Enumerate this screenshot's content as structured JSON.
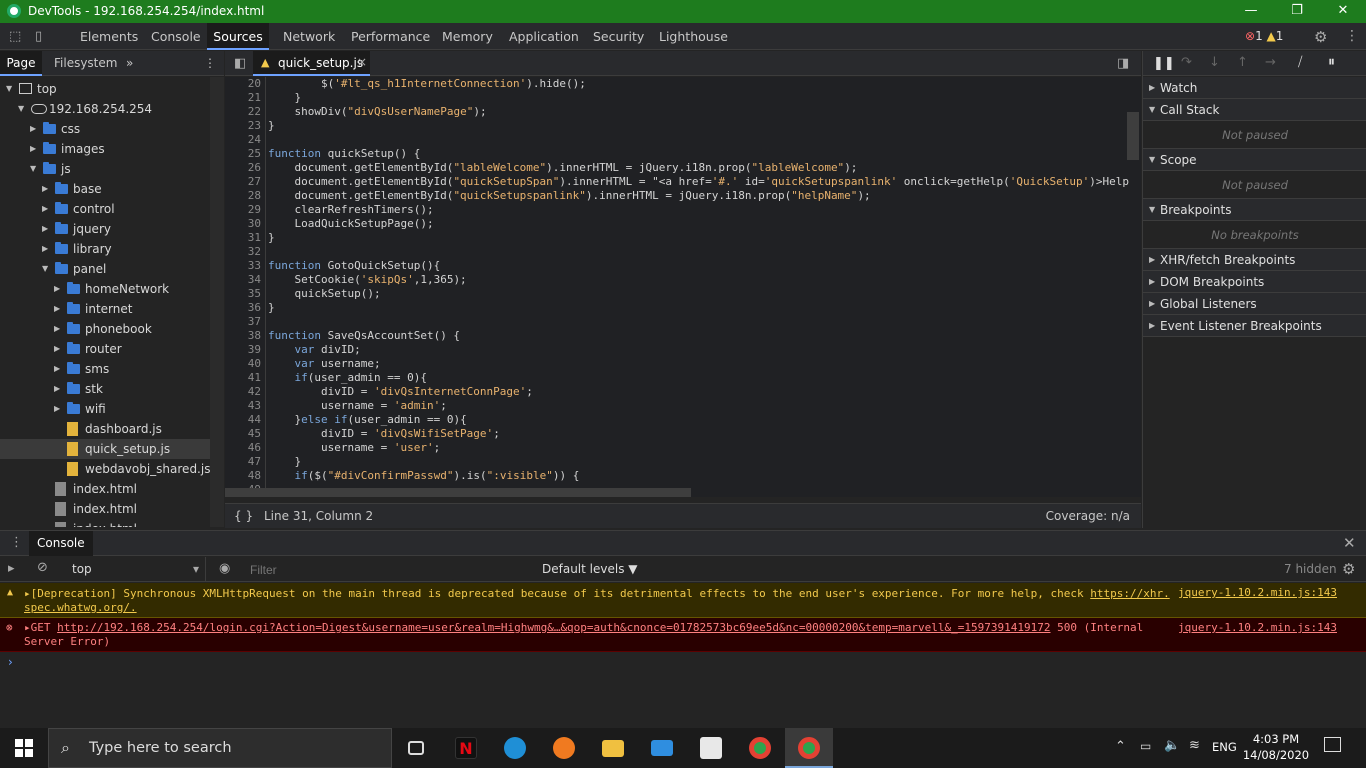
{
  "window": {
    "title": "DevTools - 192.168.254.254/index.html",
    "minimize_glyph": "—",
    "restore_glyph": "❐",
    "close_glyph": "✕"
  },
  "main_tabs": [
    {
      "label": "Elements"
    },
    {
      "label": "Console"
    },
    {
      "label": "Sources"
    },
    {
      "label": "Network"
    },
    {
      "label": "Performance"
    },
    {
      "label": "Memory"
    },
    {
      "label": "Application"
    },
    {
      "label": "Security"
    },
    {
      "label": "Lighthouse"
    }
  ],
  "active_main_tab": "Sources",
  "issues": {
    "errors": "1",
    "warnings": "1"
  },
  "navigator": {
    "tabs": [
      {
        "label": "Page"
      },
      {
        "label": "Filesystem"
      }
    ],
    "more": "»",
    "tree": [
      {
        "label": "top",
        "type": "frame"
      },
      {
        "label": "192.168.254.254",
        "type": "cloud"
      },
      {
        "label": "css",
        "type": "folder"
      },
      {
        "label": "images",
        "type": "folder"
      },
      {
        "label": "js",
        "type": "folder"
      },
      {
        "label": "base",
        "type": "folder"
      },
      {
        "label": "control",
        "type": "folder"
      },
      {
        "label": "jquery",
        "type": "folder"
      },
      {
        "label": "library",
        "type": "folder"
      },
      {
        "label": "panel",
        "type": "folder"
      },
      {
        "label": "homeNetwork",
        "type": "folder"
      },
      {
        "label": "internet",
        "type": "folder"
      },
      {
        "label": "phonebook",
        "type": "folder"
      },
      {
        "label": "router",
        "type": "folder"
      },
      {
        "label": "sms",
        "type": "folder"
      },
      {
        "label": "stk",
        "type": "folder"
      },
      {
        "label": "wifi",
        "type": "folder"
      },
      {
        "label": "dashboard.js",
        "type": "js"
      },
      {
        "label": "quick_setup.js",
        "type": "js"
      },
      {
        "label": "webdavobj_shared.js",
        "type": "js"
      },
      {
        "label": "index.html",
        "type": "html"
      },
      {
        "label": "index.html",
        "type": "html"
      },
      {
        "label": "index.html",
        "type": "html"
      }
    ]
  },
  "editor": {
    "tab_label": "quick_setup.js",
    "lines": [
      {
        "n": "20",
        "t": "        $('#lt_qs_h1InternetConnection').hide();"
      },
      {
        "n": "21",
        "t": "    }"
      },
      {
        "n": "22",
        "t": "    showDiv(\"divQsUserNamePage\");"
      },
      {
        "n": "23",
        "t": "}"
      },
      {
        "n": "24",
        "t": ""
      },
      {
        "n": "25",
        "t": "function quickSetup() {"
      },
      {
        "n": "26",
        "t": "    document.getElementById(\"lableWelcome\").innerHTML = jQuery.i18n.prop(\"lableWelcome\");"
      },
      {
        "n": "27",
        "t": "    document.getElementById(\"quickSetupSpan\").innerHTML = \"<a href='#.' id='quickSetupspanlink' onclick=getHelp('QuickSetup')>Help"
      },
      {
        "n": "28",
        "t": "    document.getElementById(\"quickSetupspanlink\").innerHTML = jQuery.i18n.prop(\"helpName\");"
      },
      {
        "n": "29",
        "t": "    clearRefreshTimers();"
      },
      {
        "n": "30",
        "t": "    LoadQuickSetupPage();"
      },
      {
        "n": "31",
        "t": "}"
      },
      {
        "n": "32",
        "t": ""
      },
      {
        "n": "33",
        "t": "function GotoQuickSetup(){"
      },
      {
        "n": "34",
        "t": "    SetCookie('skipQs',1,365);"
      },
      {
        "n": "35",
        "t": "    quickSetup();"
      },
      {
        "n": "36",
        "t": "}"
      },
      {
        "n": "37",
        "t": ""
      },
      {
        "n": "38",
        "t": "function SaveQsAccountSet() {"
      },
      {
        "n": "39",
        "t": "    var divID;"
      },
      {
        "n": "40",
        "t": "    var username;"
      },
      {
        "n": "41",
        "t": "    if(user_admin == 0){"
      },
      {
        "n": "42",
        "t": "        divID = 'divQsInternetConnPage';"
      },
      {
        "n": "43",
        "t": "        username = 'admin';"
      },
      {
        "n": "44",
        "t": "    }else if(user_admin == 0){"
      },
      {
        "n": "45",
        "t": "        divID = 'divQsWifiSetPage';"
      },
      {
        "n": "46",
        "t": "        username = 'user';"
      },
      {
        "n": "47",
        "t": "    }"
      },
      {
        "n": "48",
        "t": "    if($(\"#divConfirmPasswd\").is(\":visible\")) {"
      },
      {
        "n": "49",
        "t": ""
      }
    ],
    "status_braces": "{ }",
    "status_position": "Line 31, Column 2",
    "coverage": "Coverage: n/a"
  },
  "debugger": {
    "sections": [
      {
        "label": "Watch",
        "expanded": false
      },
      {
        "label": "Call Stack",
        "expanded": true,
        "content": "Not paused"
      },
      {
        "label": "Scope",
        "expanded": true,
        "content": "Not paused"
      },
      {
        "label": "Breakpoints",
        "expanded": true,
        "content": "No breakpoints"
      },
      {
        "label": "XHR/fetch Breakpoints",
        "expanded": false
      },
      {
        "label": "DOM Breakpoints",
        "expanded": false
      },
      {
        "label": "Global Listeners",
        "expanded": false
      },
      {
        "label": "Event Listener Breakpoints",
        "expanded": false
      }
    ]
  },
  "console": {
    "drawer_tab": "Console",
    "context": "top",
    "filter_placeholder": "Filter",
    "levels": "Default levels ▼",
    "hidden": "7 hidden",
    "messages": [
      {
        "level": "warning",
        "line1": "▸[Deprecation] Synchronous XMLHttpRequest on the main thread is deprecated because of its detrimental effects to the end user's experience. For more help, check",
        "link1": "https://xhr.",
        "line2": "spec.whatwg.org/.",
        "source": "jquery-1.10.2.min.js:143"
      },
      {
        "level": "error",
        "prefix": "▸GET",
        "url": "http://192.168.254.254/login.cgi?Action=Digest&username=user&realm=Highwmg&…&qop=auth&cnonce=01782573bc69ee5d&nc=00000200&temp=marvell&_=1597391419172",
        "suffix": "500 (Internal",
        "line2": "Server Error)",
        "source": "jquery-1.10.2.min.js:143"
      }
    ],
    "prompt": "›"
  },
  "taskbar": {
    "search_placeholder": "Type here to search",
    "lang": "ENG",
    "time": "4:03 PM",
    "date": "14/08/2020"
  },
  "colors": {
    "titlebar": "#1e7c1e",
    "accent": "#6ea2ff",
    "warning": "#f2c94c",
    "error": "#ff8080"
  }
}
